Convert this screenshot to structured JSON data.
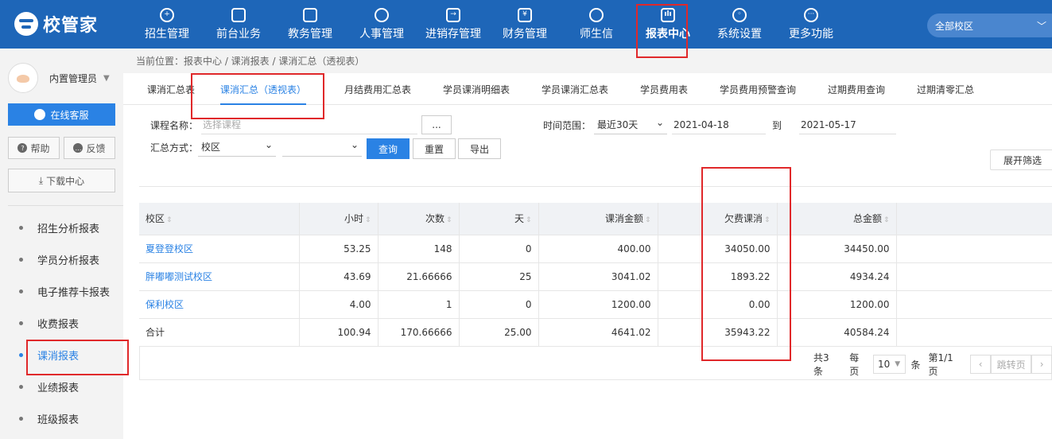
{
  "app": {
    "logo_text": "校管家"
  },
  "nav": [
    {
      "label": "招生管理",
      "icon": "user-plus-icon"
    },
    {
      "label": "前台业务",
      "icon": "monitor-icon"
    },
    {
      "label": "教务管理",
      "icon": "book-icon"
    },
    {
      "label": "人事管理",
      "icon": "person-icon"
    },
    {
      "label": "进销存管理",
      "icon": "arrow-box-icon"
    },
    {
      "label": "财务管理",
      "icon": "yen-icon"
    },
    {
      "label": "师生信",
      "icon": "chat-icon"
    },
    {
      "label": "报表中心",
      "icon": "chart-icon"
    },
    {
      "label": "系统设置",
      "icon": "settings-icon"
    },
    {
      "label": "更多功能",
      "icon": "more-icon"
    }
  ],
  "campus_select": {
    "value": "全部校区"
  },
  "user": {
    "name": "内置管理员"
  },
  "sidebar": {
    "service": "在线客服",
    "help": "帮助",
    "feedback": "反馈",
    "download": "下载中心",
    "menu": [
      "招生分析报表",
      "学员分析报表",
      "电子推荐卡报表",
      "收费报表",
      "课消报表",
      "业绩报表",
      "班级报表"
    ]
  },
  "breadcrumb": "当前位置：报表中心 / 课消报表 / 课消汇总（透视表）",
  "tabs": [
    "课消汇总表",
    "课消汇总（透视表）",
    "月结费用汇总表",
    "学员课消明细表",
    "学员课消汇总表",
    "学员费用表",
    "学员费用预警查询",
    "过期费用查询",
    "过期清零汇总"
  ],
  "filters": {
    "course_label": "课程名称：",
    "course_placeholder": "选择课程",
    "ellipsis": "...",
    "mode_label": "汇总方式：",
    "mode_value": "校区",
    "mode_value2": "",
    "time_label": "时间范围：",
    "time_range": "最近30天",
    "start_date": "2021-04-18",
    "to": "到",
    "end_date": "2021-05-17",
    "query": "查询",
    "reset": "重置",
    "export": "导出",
    "expand": "展开筛选"
  },
  "table": {
    "headers": [
      "校区",
      "小时",
      "次数",
      "天",
      "课消金额",
      "欠费课消",
      "总金额"
    ],
    "rows": [
      [
        "夏登登校区",
        "53.25",
        "148",
        "0",
        "400.00",
        "34050.00",
        "34450.00"
      ],
      [
        "胖嘟嘟测试校区",
        "43.69",
        "21.66666",
        "25",
        "3041.02",
        "1893.22",
        "4934.24"
      ],
      [
        "保利校区",
        "4.00",
        "1",
        "0",
        "1200.00",
        "0.00",
        "1200.00"
      ],
      [
        "合计",
        "100.94",
        "170.66666",
        "25.00",
        "4641.02",
        "35943.22",
        "40584.24"
      ]
    ]
  },
  "pager": {
    "total": "共3条",
    "per_page_label": "每页",
    "per_page": "10",
    "unit": "条",
    "page": "第1/1页",
    "jump": "跳转页"
  },
  "colors": {
    "topbar": "#1e66b8",
    "accent": "#2a82e4",
    "annotation": "#e0282a"
  }
}
